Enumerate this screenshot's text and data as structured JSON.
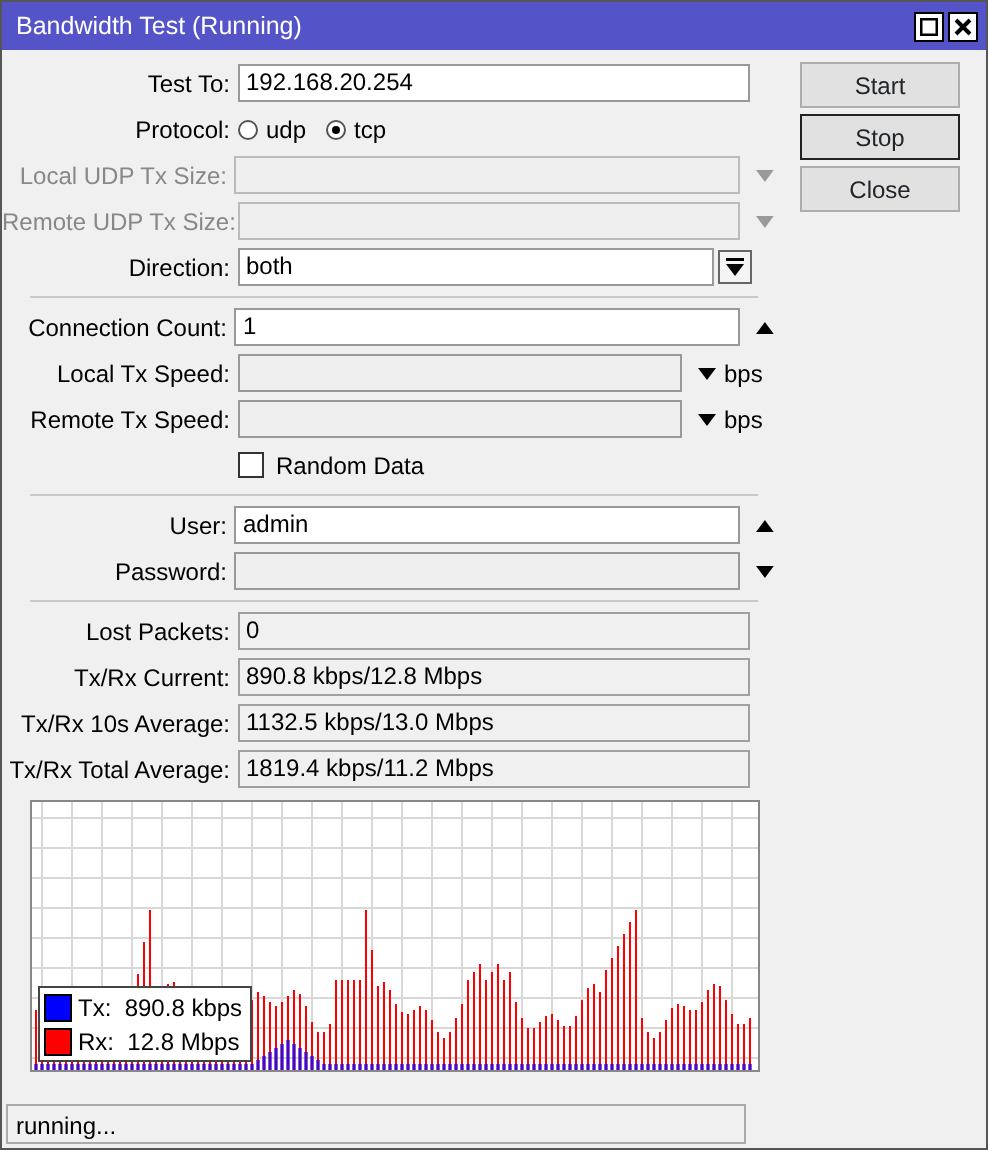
{
  "window": {
    "title": "Bandwidth Test (Running)"
  },
  "sections": [
    [
      {
        "kind": "text",
        "label": "Test To:",
        "value": "192.168.20.254",
        "disabled": false,
        "unset": false
      },
      {
        "kind": "radio",
        "label": "Protocol:",
        "options": [
          {
            "label": "udp",
            "selected": false
          },
          {
            "label": "tcp",
            "selected": true
          }
        ]
      },
      {
        "kind": "text",
        "label": "Local UDP Tx Size:",
        "disabled": true,
        "unset": true,
        "expanded": false
      },
      {
        "kind": "text",
        "label": "Remote UDP Tx Size:",
        "disabled": true,
        "unset": true,
        "expanded": false
      },
      {
        "kind": "select",
        "label": "Direction:",
        "value": "both"
      }
    ],
    [
      {
        "kind": "text",
        "label": "Connection Count:",
        "value": "1",
        "disabled": false,
        "unset": false,
        "expanded": true
      },
      {
        "kind": "text",
        "label": "Local Tx Speed:",
        "disabled": false,
        "unset": true,
        "expanded": false,
        "unit": "bps"
      },
      {
        "kind": "text",
        "label": "Remote Tx Speed:",
        "disabled": false,
        "unset": true,
        "expanded": false,
        "unit": "bps"
      },
      {
        "kind": "checkbox",
        "label": "Random Data",
        "checked": false
      }
    ],
    [
      {
        "kind": "text",
        "label": "User:",
        "value": "admin",
        "disabled": false,
        "unset": false,
        "expanded": true
      },
      {
        "kind": "text",
        "label": "Password:",
        "disabled": false,
        "unset": true,
        "expanded": false
      }
    ],
    [
      {
        "kind": "readonly",
        "label": "Lost Packets:",
        "value": "0"
      },
      {
        "kind": "readonly",
        "label": "Tx/Rx Current:",
        "value": "890.8 kbps/12.8 Mbps"
      },
      {
        "kind": "readonly",
        "label": "Tx/Rx 10s Average:",
        "value": "1132.5 kbps/13.0 Mbps"
      },
      {
        "kind": "readonly",
        "label": "Tx/Rx Total Average:",
        "value": "1819.4 kbps/11.2 Mbps"
      }
    ]
  ],
  "buttons": [
    {
      "label": "Start",
      "focused": false
    },
    {
      "label": "Stop",
      "focused": true
    },
    {
      "label": "Close",
      "focused": false
    }
  ],
  "graph": {
    "legend": [
      {
        "label": "Tx:  890.8 kbps",
        "color": "#0000ff"
      },
      {
        "label": "Rx:  12.8 Mbps",
        "color": "#ff0000"
      }
    ]
  },
  "status_bar": "running..."
}
